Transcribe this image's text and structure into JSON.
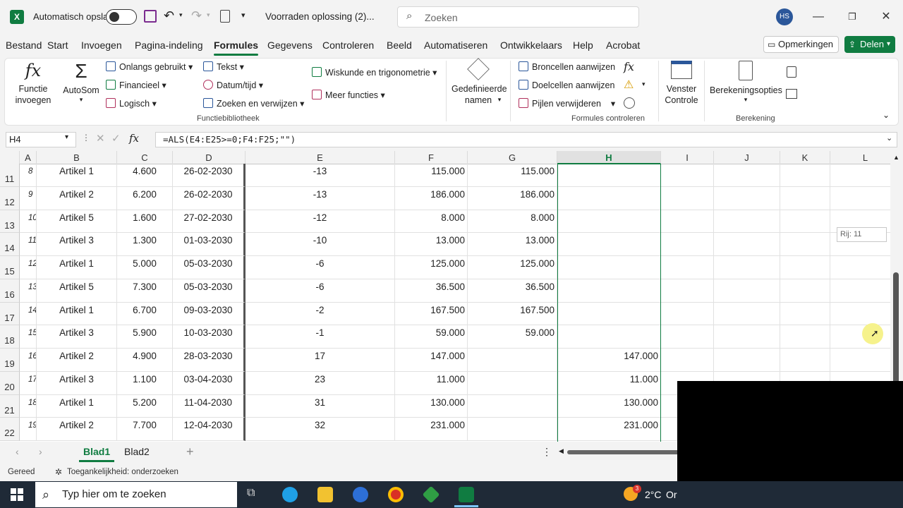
{
  "titlebar": {
    "autosave_label": "Automatisch opslaan",
    "doc_title": "Voorraden oplossing (2)...",
    "search_placeholder": "Zoeken",
    "avatar_initials": "HS"
  },
  "menu": {
    "tabs": [
      "Bestand",
      "Start",
      "Invoegen",
      "Pagina-indeling",
      "Formules",
      "Gegevens",
      "Controleren",
      "Beeld",
      "Automatiseren",
      "Ontwikkelaars",
      "Help",
      "Acrobat"
    ],
    "active_tab": "Formules",
    "comments_label": "Opmerkingen",
    "share_label": "Delen"
  },
  "ribbon": {
    "insert_function": "Functie invoegen",
    "autosum": "AutoSom",
    "recent": "Onlangs gebruikt",
    "financial": "Financieel",
    "logical": "Logisch",
    "text": "Tekst",
    "datetime": "Datum/tijd",
    "lookup": "Zoeken en verwijzen",
    "math": "Wiskunde en trigonometrie",
    "more": "Meer functies",
    "group_library": "Functiebibliotheek",
    "defined_names": "Gedefinieerde namen",
    "trace_precedents": "Broncellen aanwijzen",
    "trace_dependents": "Doelcellen aanwijzen",
    "remove_arrows": "Pijlen verwijderen",
    "watch_window": "Venster Controle",
    "group_auditing": "Formules controleren",
    "calc_options": "Berekeningsopties",
    "group_calc": "Berekening"
  },
  "formulabar": {
    "namebox": "H4",
    "formula": "=ALS(E4:E25>=0;F4:F25;\"\")"
  },
  "grid": {
    "columns": [
      "A",
      "B",
      "C",
      "D",
      "E",
      "F",
      "G",
      "H",
      "I",
      "J",
      "K",
      "L"
    ],
    "selected_column": "H",
    "rows": [
      {
        "num": "11",
        "a": "8",
        "b": "Artikel 1",
        "c": "4.600",
        "d": "26-02-2030",
        "e": "-13",
        "f": "115.000",
        "g": "115.000",
        "h": ""
      },
      {
        "num": "12",
        "a": "9",
        "b": "Artikel 2",
        "c": "6.200",
        "d": "26-02-2030",
        "e": "-13",
        "f": "186.000",
        "g": "186.000",
        "h": ""
      },
      {
        "num": "13",
        "a": "10",
        "b": "Artikel 5",
        "c": "1.600",
        "d": "27-02-2030",
        "e": "-12",
        "f": "8.000",
        "g": "8.000",
        "h": ""
      },
      {
        "num": "14",
        "a": "11",
        "b": "Artikel 3",
        "c": "1.300",
        "d": "01-03-2030",
        "e": "-10",
        "f": "13.000",
        "g": "13.000",
        "h": ""
      },
      {
        "num": "15",
        "a": "12",
        "b": "Artikel 1",
        "c": "5.000",
        "d": "05-03-2030",
        "e": "-6",
        "f": "125.000",
        "g": "125.000",
        "h": ""
      },
      {
        "num": "16",
        "a": "13",
        "b": "Artikel 5",
        "c": "7.300",
        "d": "05-03-2030",
        "e": "-6",
        "f": "36.500",
        "g": "36.500",
        "h": ""
      },
      {
        "num": "17",
        "a": "14",
        "b": "Artikel 1",
        "c": "6.700",
        "d": "09-03-2030",
        "e": "-2",
        "f": "167.500",
        "g": "167.500",
        "h": ""
      },
      {
        "num": "18",
        "a": "15",
        "b": "Artikel 3",
        "c": "5.900",
        "d": "10-03-2030",
        "e": "-1",
        "f": "59.000",
        "g": "59.000",
        "h": ""
      },
      {
        "num": "19",
        "a": "16",
        "b": "Artikel 2",
        "c": "4.900",
        "d": "28-03-2030",
        "e": "17",
        "f": "147.000",
        "g": "",
        "h": "147.000"
      },
      {
        "num": "20",
        "a": "17",
        "b": "Artikel 3",
        "c": "1.100",
        "d": "03-04-2030",
        "e": "23",
        "f": "11.000",
        "g": "",
        "h": "11.000"
      },
      {
        "num": "21",
        "a": "18",
        "b": "Artikel 1",
        "c": "5.200",
        "d": "11-04-2030",
        "e": "31",
        "f": "130.000",
        "g": "",
        "h": "130.000"
      },
      {
        "num": "22",
        "a": "19",
        "b": "Artikel 2",
        "c": "7.700",
        "d": "12-04-2030",
        "e": "32",
        "f": "231.000",
        "g": "",
        "h": "231.000"
      }
    ],
    "tooltip": "Rij: 11"
  },
  "sheets": {
    "tabs": [
      "Blad1",
      "Blad2"
    ],
    "active": "Blad1"
  },
  "statusbar": {
    "ready": "Gereed",
    "accessibility": "Toegankelijkheid: onderzoeken"
  },
  "taskbar": {
    "search_placeholder": "Typ hier om te zoeken",
    "weather": "2°C",
    "weather_cut": "Or",
    "badge": "3"
  },
  "colors": {
    "excel_green": "#107c41",
    "taskbar": "#1f2a37"
  }
}
